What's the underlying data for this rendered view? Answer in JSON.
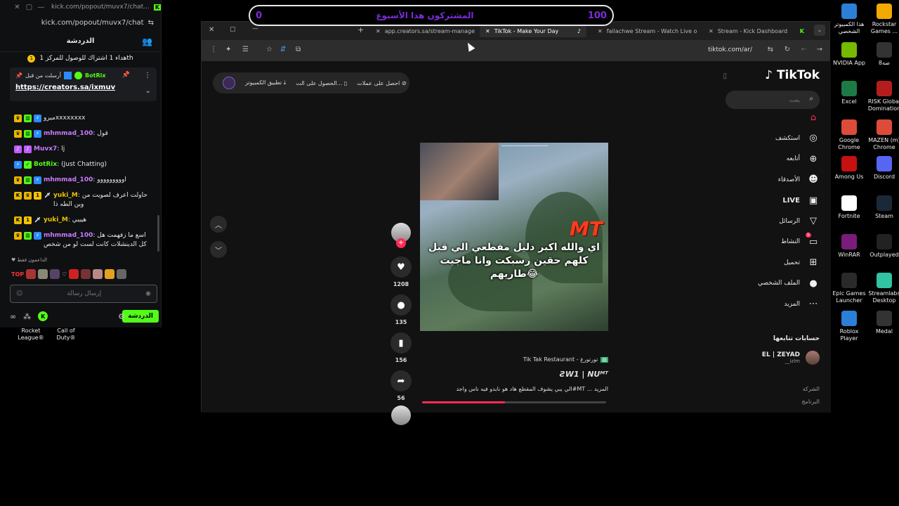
{
  "goal_overlay": {
    "left_value": "0",
    "title": "المشتركون هذا الأسبوع",
    "right_value": "100"
  },
  "chat_window": {
    "title": "kick.com/popout/muvx7/chat...",
    "url": "kick.com/popout/muvx7/chat",
    "header": "الدردشة",
    "goal_text": "هداء 1 اشتراك للوصول للمركز 1th",
    "pinned": {
      "by_label": "أرسلت من قبل",
      "user": "BotRix",
      "link": "https://creators.sa/ixmuv"
    },
    "messages": [
      {
        "user": "",
        "text": "ميروxxxxxxxx",
        "color": "#c97cff",
        "badges": [
          "crown",
          "sub",
          "bot"
        ],
        "hidden_user": true
      },
      {
        "user": "mhmmad_100",
        "text": "قول",
        "color": "#c97cff",
        "badges": [
          "crown",
          "sub",
          "bot"
        ]
      },
      {
        "user": "Muvx7",
        "text": "lj",
        "color": "#c97cff",
        "badges": [
          "mic",
          "mic"
        ]
      },
      {
        "user": "BotRix",
        "text": "(Just Chatting)",
        "color": "#53fc18",
        "badges": [
          "bot",
          "ver"
        ]
      },
      {
        "user": "mhmmad_100",
        "text": "اووووووووو",
        "color": "#c97cff",
        "badges": [
          "crown",
          "sub",
          "bot"
        ]
      },
      {
        "user": "yuki_M",
        "text": "حاولت اعرف لصويت من وين الطه ذا",
        "color": "#e8c200",
        "badges": [
          "k",
          "crown",
          "coin",
          "sword"
        ]
      },
      {
        "user": "yuki_M",
        "text": "هييبي",
        "color": "#e8c200",
        "badges": [
          "k",
          "coin",
          "sword"
        ]
      },
      {
        "user": "mhmmad_100",
        "text": "اسع ما زفهمت هل كل الدينشلات كانت لست لو من شخص",
        "color": "#c97cff",
        "badges": [
          "crown",
          "sub",
          "bot"
        ]
      }
    ],
    "supporters_label": "الداعمون فقط",
    "top_label": "TOP",
    "input_placeholder": "إرسال رسالة",
    "send_label": "الدردشة"
  },
  "browser": {
    "tabs": [
      {
        "title": "app.creators.sa/stream-manage"
      },
      {
        "title": "TikTok - Make Your Day"
      },
      {
        "title": "failachwe Stream - Watch Live o"
      },
      {
        "title": "Stream - Kick Dashboard"
      }
    ],
    "url": "tiktok.com/ar/",
    "top_pill": {
      "desktop_app": "تطبيق الكمبيوتر",
      "get_on": "الحصول على الت...",
      "coins": "احصل على عملات"
    },
    "video": {
      "caption": "اي والله اكبر دليل مقطعي الي قبل كلهم حقين رسبكت وانا ماجيت طاريهم😂",
      "watermark": "MT",
      "author": "Tik Tak Restaurant - تورتورغ",
      "title": "ƧW1 | NUᴹᵀ",
      "description": "الي يبي يشوف المقطع هاد هو نابدو فيه ناس واجد#MT ... المزيد",
      "progress": 0.45
    },
    "rail": {
      "likes": "1208",
      "comments": "135",
      "saves": "156",
      "shares": "56"
    },
    "sidebar": {
      "logo": "TikTok",
      "search_placeholder": "بحث",
      "items": [
        {
          "label": "",
          "icon": "home-icon"
        },
        {
          "label": "استكشف",
          "icon": "compass-icon"
        },
        {
          "label": "أتابعه",
          "icon": "follow-icon"
        },
        {
          "label": "الأصدقاء",
          "icon": "friends-icon"
        },
        {
          "label": "LIVE",
          "icon": "live-icon"
        },
        {
          "label": "الرسائل",
          "icon": "send-icon"
        },
        {
          "label": "النشاط",
          "icon": "activity-icon"
        },
        {
          "label": "تحميل",
          "icon": "upload-icon"
        },
        {
          "label": "الملف الشخصي",
          "icon": "profile-icon"
        },
        {
          "label": "المزيد",
          "icon": "more-icon"
        }
      ],
      "activity_badge": "5",
      "following_title": "حسابات تتابعها",
      "following": {
        "name": "EL | ZEYAD",
        "handle": "__izlm"
      },
      "footer_company": "الشركة",
      "footer_program": "البرنامج"
    }
  },
  "desktop": {
    "icons": [
      {
        "label": "هذا الكمبيوتر الشخصي",
        "color": "#2c7fd6"
      },
      {
        "label": "Rockstar Games ...",
        "color": "#f2a900"
      },
      {
        "label": "NVIDIA App",
        "color": "#76b900"
      },
      {
        "label": "8صه",
        "color": "#333333"
      },
      {
        "label": "Excel",
        "color": "#1d7a45"
      },
      {
        "label": "RISK Global Domination",
        "color": "#b51d1d"
      },
      {
        "label": "Google Chrome",
        "color": "#dd4b39"
      },
      {
        "label": "MAZEN (m) Chrome",
        "color": "#dd4b39"
      },
      {
        "label": "Among Us",
        "color": "#c51111"
      },
      {
        "label": "Discord",
        "color": "#5865f2"
      },
      {
        "label": "Fortnite",
        "color": "#ffffff"
      },
      {
        "label": "Steam",
        "color": "#1b2838"
      },
      {
        "label": "WinRAR",
        "color": "#7a1c7a"
      },
      {
        "label": "Outplayed",
        "color": "#222222"
      },
      {
        "label": "Epic Games Launcher",
        "color": "#2a2a2a"
      },
      {
        "label": "Streamlabs Desktop",
        "color": "#31c3a2"
      },
      {
        "label": "Roblox Player",
        "color": "#2c7fd6"
      },
      {
        "label": "Medal",
        "color": "#333333"
      }
    ],
    "left_icons": [
      {
        "label": "Rocket League®"
      },
      {
        "label": "Call of Duty®"
      }
    ]
  }
}
